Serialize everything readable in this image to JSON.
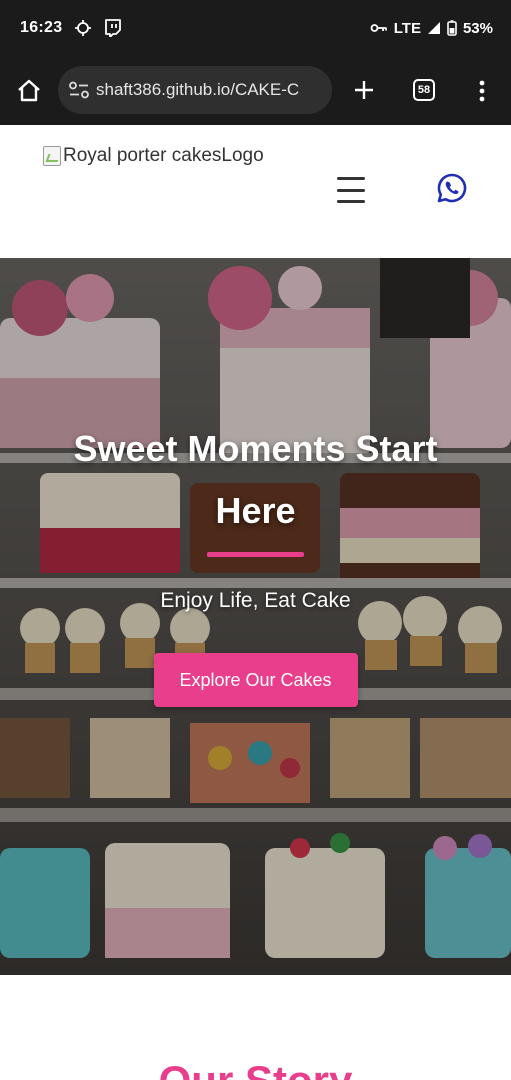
{
  "status_bar": {
    "time": "16:23",
    "network": "LTE",
    "battery": "53%"
  },
  "browser": {
    "url": "shaft386.github.io/CAKE-C",
    "tab_count": "58"
  },
  "header": {
    "logo_alt": "Royal porter cakesLogo"
  },
  "hero": {
    "title": "Sweet Moments Start Here",
    "subtitle": "Enjoy Life, Eat Cake",
    "button_label": "Explore Our Cakes"
  },
  "story": {
    "title": "Our Story"
  },
  "colors": {
    "accent": "#e83e8c",
    "whatsapp": "#1f2fb5",
    "status_bar": "#1b1b1b"
  }
}
